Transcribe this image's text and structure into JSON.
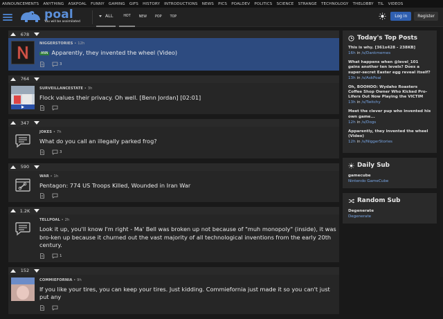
{
  "topbar": {
    "links": [
      "ANNOUNCEMENTS",
      "ANYTHING",
      "ASKPOAL",
      "FUNNY",
      "GAMING",
      "GIFS",
      "HISTORY",
      "INTRODUCTIONS",
      "NEWS",
      "PICS",
      "POALDEV",
      "POLITICS",
      "SCIENCE",
      "STRANGE",
      "TECHNOLOGY",
      "THELOBBY",
      "TIL",
      "VIDEOS"
    ]
  },
  "header": {
    "logo_text": "poal",
    "logo_tagline": "You will be assimilated",
    "all_label": "ALL",
    "tabs": [
      "HOT",
      "NEW",
      "POP",
      "TOP"
    ],
    "login_label": "Log in",
    "register_label": "Register"
  },
  "posts": [
    {
      "score": "678",
      "sub": "NIGGERSTORIES",
      "time": "12h",
      "tag": "ANN",
      "title": "Apparently, they invented the wheel (Video)",
      "comments": "3",
      "thumb": "N",
      "highlight": true
    },
    {
      "score": "764",
      "sub": "SURVEILLANCESTATE",
      "time": "3h",
      "tag": "",
      "title": "Flock values their privacy. Oh well. [Benn Jordan] [02:01]",
      "comments": "",
      "thumb": "image"
    },
    {
      "score": "347",
      "sub": "JOKES",
      "time": "7h",
      "tag": "",
      "title": "What do you call an illegally parked frog?",
      "comments": "3",
      "thumb": "comment-icon"
    },
    {
      "score": "590",
      "sub": "WAR",
      "time": "1h",
      "tag": "",
      "title": "Pentagon: 774 US Troops Killed, Wounded in Iran War",
      "comments": "",
      "thumb": "link-icon"
    },
    {
      "score": "1.2K",
      "sub": "TELLPOAL",
      "time": "2h",
      "tag": "",
      "title": "Look it up, you'll know I'm right - Ma' Bell was broken up not because of \"muh monopoly\" (inside), it was bro-ken up because it churned out the vast majority of all technological inventions from the early 20th century.",
      "comments": "1",
      "thumb": "comment-icon"
    },
    {
      "score": "152",
      "sub": "COMMIEFORNIA",
      "time": "9h",
      "tag": "",
      "title": "If you like your tires, you can keep your tires. Just kidding. Commiefornia just made it so you can't just put any",
      "comments": "",
      "thumb": "image"
    }
  ],
  "sidebar": {
    "top_title": "Today's Top Posts",
    "top_posts": [
      {
        "title": "This is why. [361x428 - 238KB]",
        "time": "16h",
        "sub": "/s/Dankmemes"
      },
      {
        "title": "What happens when @level_101 gains another ten levels? Does a super-secret Easter egg reveal itself?",
        "time": "13h",
        "sub": "/s/AskPoal"
      },
      {
        "title": "Oh, BOOHOO: Wydaho Roasters Coffee Shop Owner Who Kicked Pro-Lifers Out Now Playing the VICTIM",
        "time": "13h",
        "sub": "/s/Twitchy"
      },
      {
        "title": "Meet the clever pup who invented his own game...",
        "time": "12h",
        "sub": "/s/Dogs"
      },
      {
        "title": "Apparently, they invented the wheel (Video)",
        "time": "12h",
        "sub": "/s/NiggerStories"
      }
    ],
    "daily_title": "Daily Sub",
    "daily_name": "gamecube",
    "daily_desc": "Nintendo GameCube",
    "random_title": "Random Sub",
    "random_name": "Degenerate",
    "random_desc": "Degenerate",
    "time_suffix": " in "
  }
}
